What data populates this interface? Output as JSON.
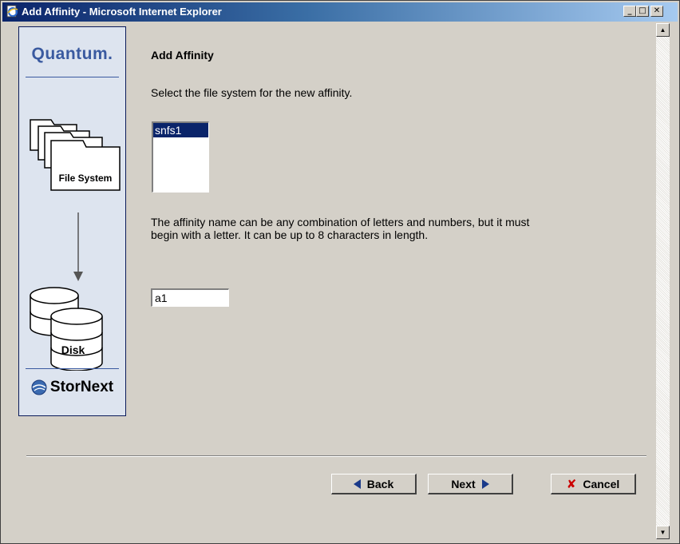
{
  "window": {
    "title": "Add Affinity - Microsoft Internet Explorer",
    "controls": {
      "minimize": "_",
      "maximize": "□",
      "close": "✕"
    },
    "icon": "ie-page-icon"
  },
  "sidebar": {
    "brand": "Quantum.",
    "illustration_labels": {
      "file_system": "File System",
      "disk": "Disk"
    },
    "footer_brand": "StorNext",
    "colors": {
      "panel": "#dde4ef",
      "accent": "#3a5aa0"
    }
  },
  "main": {
    "heading": "Add Affinity",
    "prompt": "Select the file system for the new affinity.",
    "file_systems": [
      {
        "label": "snfs1",
        "selected": true
      }
    ],
    "description": "The affinity name can be any combination of letters and numbers, but it must begin with a letter. It can be up to 8 characters in length.",
    "affinity_name_value": "a1"
  },
  "buttons": {
    "back": "Back",
    "next": "Next",
    "cancel": "Cancel"
  },
  "colors": {
    "window_bg": "#d4d0c8",
    "title_start": "#0a246a",
    "selection": "#0a246a",
    "cancel_icon": "#cc0000"
  }
}
